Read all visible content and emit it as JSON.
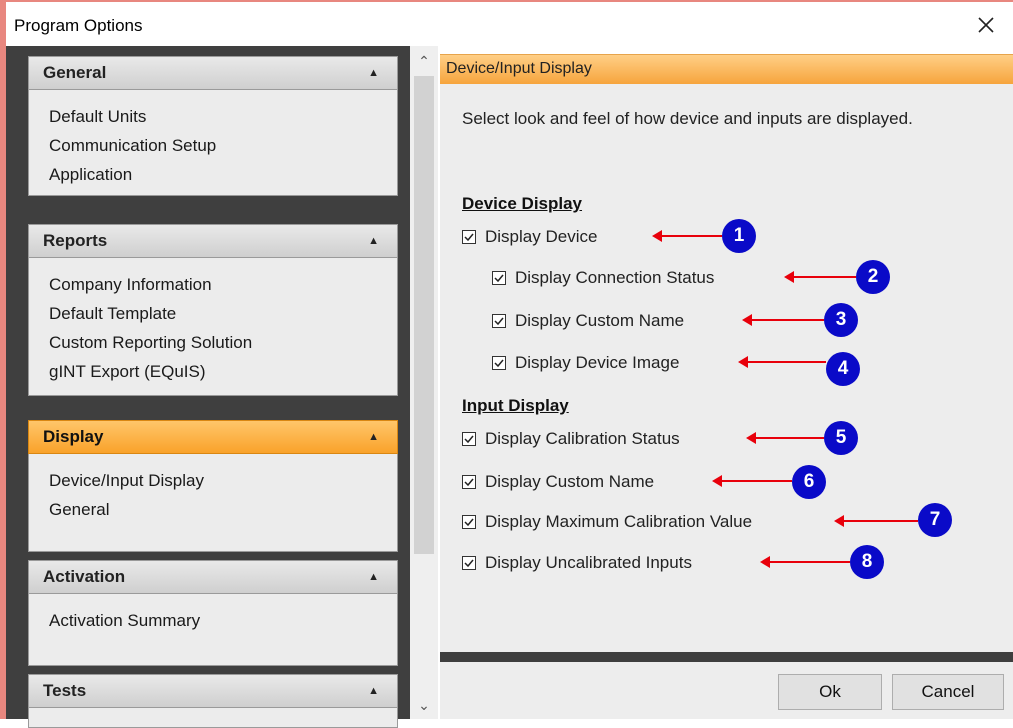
{
  "window": {
    "title": "Program Options",
    "close_icon": "close-icon"
  },
  "nav": {
    "groups": [
      {
        "title": "General",
        "active": false,
        "items": [
          "Default Units",
          "Communication Setup",
          "Application"
        ]
      },
      {
        "title": "Reports",
        "active": false,
        "items": [
          "Company Information",
          "Default Template",
          "Custom Reporting Solution",
          "gINT Export (EQuIS)"
        ]
      },
      {
        "title": "Display",
        "active": true,
        "items": [
          "Device/Input Display",
          "General"
        ]
      },
      {
        "title": "Activation",
        "active": false,
        "items": [
          "Activation Summary"
        ]
      },
      {
        "title": "Tests",
        "active": false,
        "items": []
      }
    ]
  },
  "content": {
    "header": "Device/Input Display",
    "description": "Select look and feel of how device and inputs are displayed.",
    "device_section": {
      "title": "Device Display",
      "options": [
        {
          "label": "Display Device",
          "checked": true,
          "marker": "1"
        },
        {
          "label": "Display Connection Status",
          "checked": true,
          "marker": "2"
        },
        {
          "label": "Display Custom Name",
          "checked": true,
          "marker": "3"
        },
        {
          "label": "Display Device Image",
          "checked": true,
          "marker": "4"
        }
      ]
    },
    "input_section": {
      "title": "Input Display",
      "options": [
        {
          "label": "Display Calibration Status",
          "checked": true,
          "marker": "5"
        },
        {
          "label": "Display Custom Name",
          "checked": true,
          "marker": "6"
        },
        {
          "label": "Display Maximum Calibration Value",
          "checked": true,
          "marker": "7"
        },
        {
          "label": "Display Uncalibrated Inputs",
          "checked": true,
          "marker": "8"
        }
      ]
    }
  },
  "buttons": {
    "ok": "Ok",
    "cancel": "Cancel"
  },
  "colors": {
    "active_header": "#f9a22a",
    "marker": "#0a0ac8",
    "arrow": "#e8000b",
    "frame": "#e8877f"
  }
}
